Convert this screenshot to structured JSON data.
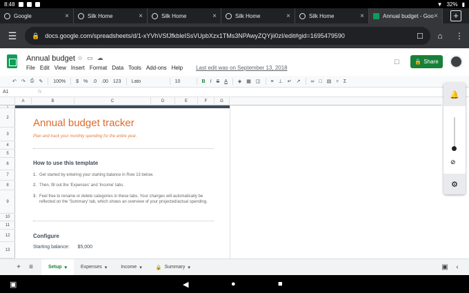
{
  "status": {
    "time": "8:48",
    "battery": "32%"
  },
  "browser_tabs": [
    {
      "title": "Google",
      "active": false
    },
    {
      "title": "Silk Home",
      "active": false
    },
    {
      "title": "Silk Home",
      "active": false
    },
    {
      "title": "Silk Home",
      "active": false
    },
    {
      "title": "Silk Home",
      "active": false
    },
    {
      "title": "Annual budget - Goog",
      "active": true
    }
  ],
  "address": {
    "url": "docs.google.com/spreadsheets/d/1-xYVhVSfJfkbleISsVUpbXzx1TMs3NPAwyZQYjii0zI/edit#gid=1695479590"
  },
  "doc": {
    "title": "Annual budget",
    "menus": [
      "File",
      "Edit",
      "View",
      "Insert",
      "Format",
      "Data",
      "Tools",
      "Add-ons",
      "Help"
    ],
    "last_edit": "Last edit was on September 13, 2018",
    "share_label": "Share"
  },
  "toolbar": {
    "zoom": "100%",
    "currency": "$",
    "percent": "%",
    "dec_less": ".0",
    "dec_more": ".00",
    "format": "123",
    "font": "Lato",
    "size": "10",
    "bold": "B",
    "italic": "I",
    "strike": "S",
    "color": "A"
  },
  "formula_bar": {
    "cell": "A1",
    "fx": "fx"
  },
  "columns": [
    "A",
    "B",
    "C",
    "D",
    "E",
    "F",
    "G"
  ],
  "rows": [
    "1",
    "2",
    "3",
    "4",
    "5",
    "6",
    "7",
    "8",
    "9",
    "10",
    "11",
    "12",
    "13"
  ],
  "sheet": {
    "heading": "Annual budget tracker",
    "subtitle": "Plan and track your monthly spending for the entire year.",
    "how_to": "How to use this template",
    "steps": [
      {
        "n": "1.",
        "text": "Get started by entering your starting balance in Row 13 below."
      },
      {
        "n": "2.",
        "text": "Then, fill out the 'Expenses' and 'Income' tabs."
      },
      {
        "n": "3.",
        "text": "Feel free to rename or delete categories in these tabs. Your changes will automatically be reflected on the 'Summary' tab, which shows an overview of your projected/actual spending."
      }
    ],
    "configure": "Configure",
    "balance_label": "Starting balance:",
    "balance_value": "$5,000"
  },
  "sheet_tabs": [
    "Setup",
    "Expenses",
    "Income",
    "Summary"
  ]
}
